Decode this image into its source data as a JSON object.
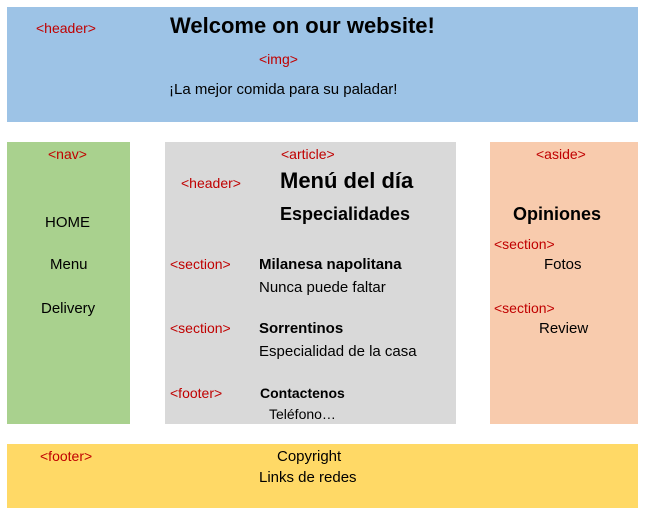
{
  "header": {
    "tag": "<header>",
    "title": "Welcome on our website!",
    "img_tag": "<img>",
    "tagline": "¡La mejor comida para su paladar!",
    "color": "#9dc3e6"
  },
  "nav": {
    "tag": "<nav>",
    "items": [
      "HOME",
      "Menu",
      "Delivery"
    ],
    "color": "#a9d18e"
  },
  "article": {
    "tag": "<article>",
    "color": "#d9d9d9",
    "header": {
      "tag": "<header>",
      "title": "Menú del día",
      "subtitle": "Especialidades"
    },
    "sections": [
      {
        "tag": "<section>",
        "title": "Milanesa napolitana",
        "text": "Nunca puede faltar"
      },
      {
        "tag": "<section>",
        "title": "Sorrentinos",
        "text": "Especialidad de la casa"
      }
    ],
    "footer": {
      "tag": "<footer>",
      "title": "Contactenos",
      "text": "Teléfono…"
    }
  },
  "aside": {
    "tag": "<aside>",
    "title": "Opiniones",
    "color": "#f8cbad",
    "sections": [
      {
        "tag": "<section>",
        "text": "Fotos"
      },
      {
        "tag": "<section>",
        "text": "Review"
      }
    ]
  },
  "footer": {
    "tag": "<footer>",
    "line1": "Copyright",
    "line2": "Links de redes",
    "color": "#ffd966"
  }
}
